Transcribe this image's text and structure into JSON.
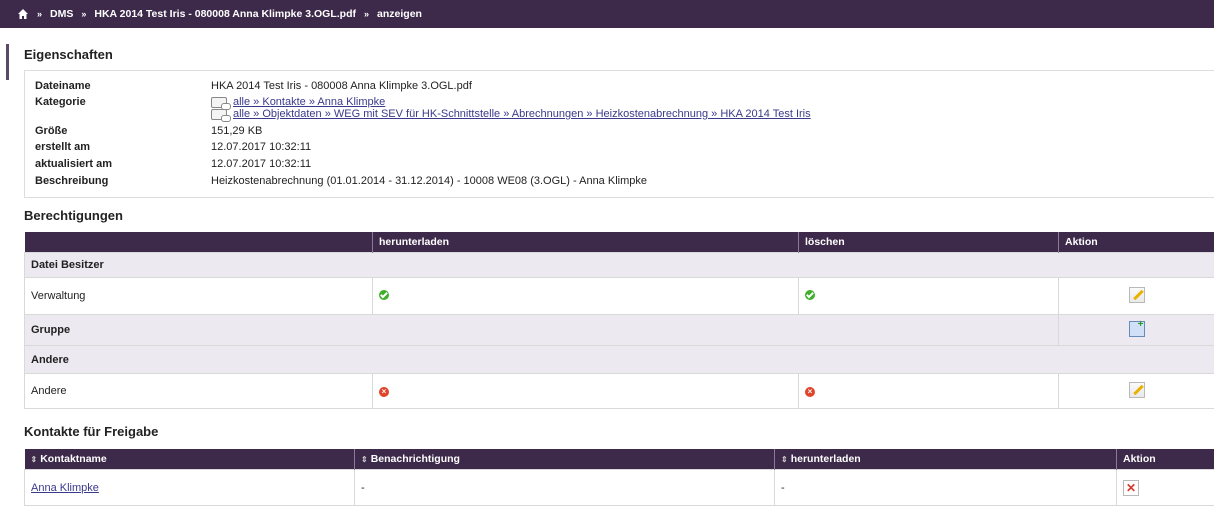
{
  "breadcrumb": {
    "items": [
      "DMS",
      "HKA 2014 Test Iris - 080008 Anna Klimpke 3.OGL.pdf",
      "anzeigen"
    ],
    "separator": "»"
  },
  "properties": {
    "heading": "Eigenschaften",
    "filename_label": "Dateiname",
    "filename": "HKA 2014 Test Iris - 080008 Anna Klimpke 3.OGL.pdf",
    "category_label": "Kategorie",
    "categories": [
      "alle » Kontakte » Anna Klimpke",
      "alle » Objektdaten » WEG mit SEV für HK-Schnittstelle » Abrechnungen » Heizkostenabrechnung » HKA 2014 Test Iris"
    ],
    "size_label": "Größe",
    "size": "151,29 KB",
    "created_label": "erstellt am",
    "created": "12.07.2017 10:32:11",
    "updated_label": "aktualisiert am",
    "updated": "12.07.2017 10:32:11",
    "description_label": "Beschreibung",
    "description": "Heizkostenabrechnung (01.01.2014 - 31.12.2014) - 10008 WE08 (3.OGL) - Anna Klimpke"
  },
  "permissions": {
    "heading": "Berechtigungen",
    "columns": [
      "",
      "herunterladen",
      "löschen",
      "Aktion"
    ],
    "owner_group": "Datei Besitzer",
    "owner_row": {
      "name": "Verwaltung",
      "download": "allowed",
      "delete": "allowed"
    },
    "group_label": "Gruppe",
    "other_group": "Andere",
    "other_row": {
      "name": "Andere",
      "download": "denied",
      "delete": "denied"
    }
  },
  "contacts": {
    "heading": "Kontakte für Freigabe",
    "columns": [
      "Kontaktname",
      "Benachrichtigung",
      "herunterladen",
      "Aktion"
    ],
    "rows": [
      {
        "name": "Anna Klimpke",
        "notification": "-",
        "download": "-"
      }
    ]
  },
  "icons": {
    "home": "home-icon",
    "allowed": "check-circle-icon",
    "denied": "x-circle-icon",
    "edit": "pencil-icon",
    "add_group": "add-group-icon",
    "delete": "delete-x-icon",
    "sort": "sort-icon"
  },
  "colors": {
    "header_bg": "#3d2a4a",
    "group_row_bg": "#ece9f0",
    "allowed": "#3fae2a",
    "denied": "#e0442a"
  }
}
